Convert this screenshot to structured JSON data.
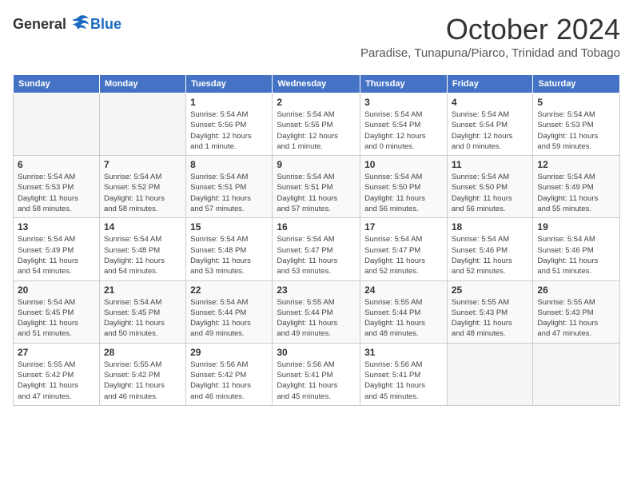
{
  "logo": {
    "general": "General",
    "blue": "Blue"
  },
  "title": "October 2024",
  "location": "Paradise, Tunapuna/Piarco, Trinidad and Tobago",
  "days_of_week": [
    "Sunday",
    "Monday",
    "Tuesday",
    "Wednesday",
    "Thursday",
    "Friday",
    "Saturday"
  ],
  "weeks": [
    [
      {
        "day": "",
        "info": ""
      },
      {
        "day": "",
        "info": ""
      },
      {
        "day": "1",
        "info": "Sunrise: 5:54 AM\nSunset: 5:56 PM\nDaylight: 12 hours\nand 1 minute."
      },
      {
        "day": "2",
        "info": "Sunrise: 5:54 AM\nSunset: 5:55 PM\nDaylight: 12 hours\nand 1 minute."
      },
      {
        "day": "3",
        "info": "Sunrise: 5:54 AM\nSunset: 5:54 PM\nDaylight: 12 hours\nand 0 minutes."
      },
      {
        "day": "4",
        "info": "Sunrise: 5:54 AM\nSunset: 5:54 PM\nDaylight: 12 hours\nand 0 minutes."
      },
      {
        "day": "5",
        "info": "Sunrise: 5:54 AM\nSunset: 5:53 PM\nDaylight: 11 hours\nand 59 minutes."
      }
    ],
    [
      {
        "day": "6",
        "info": "Sunrise: 5:54 AM\nSunset: 5:53 PM\nDaylight: 11 hours\nand 58 minutes."
      },
      {
        "day": "7",
        "info": "Sunrise: 5:54 AM\nSunset: 5:52 PM\nDaylight: 11 hours\nand 58 minutes."
      },
      {
        "day": "8",
        "info": "Sunrise: 5:54 AM\nSunset: 5:51 PM\nDaylight: 11 hours\nand 57 minutes."
      },
      {
        "day": "9",
        "info": "Sunrise: 5:54 AM\nSunset: 5:51 PM\nDaylight: 11 hours\nand 57 minutes."
      },
      {
        "day": "10",
        "info": "Sunrise: 5:54 AM\nSunset: 5:50 PM\nDaylight: 11 hours\nand 56 minutes."
      },
      {
        "day": "11",
        "info": "Sunrise: 5:54 AM\nSunset: 5:50 PM\nDaylight: 11 hours\nand 56 minutes."
      },
      {
        "day": "12",
        "info": "Sunrise: 5:54 AM\nSunset: 5:49 PM\nDaylight: 11 hours\nand 55 minutes."
      }
    ],
    [
      {
        "day": "13",
        "info": "Sunrise: 5:54 AM\nSunset: 5:49 PM\nDaylight: 11 hours\nand 54 minutes."
      },
      {
        "day": "14",
        "info": "Sunrise: 5:54 AM\nSunset: 5:48 PM\nDaylight: 11 hours\nand 54 minutes."
      },
      {
        "day": "15",
        "info": "Sunrise: 5:54 AM\nSunset: 5:48 PM\nDaylight: 11 hours\nand 53 minutes."
      },
      {
        "day": "16",
        "info": "Sunrise: 5:54 AM\nSunset: 5:47 PM\nDaylight: 11 hours\nand 53 minutes."
      },
      {
        "day": "17",
        "info": "Sunrise: 5:54 AM\nSunset: 5:47 PM\nDaylight: 11 hours\nand 52 minutes."
      },
      {
        "day": "18",
        "info": "Sunrise: 5:54 AM\nSunset: 5:46 PM\nDaylight: 11 hours\nand 52 minutes."
      },
      {
        "day": "19",
        "info": "Sunrise: 5:54 AM\nSunset: 5:46 PM\nDaylight: 11 hours\nand 51 minutes."
      }
    ],
    [
      {
        "day": "20",
        "info": "Sunrise: 5:54 AM\nSunset: 5:45 PM\nDaylight: 11 hours\nand 51 minutes."
      },
      {
        "day": "21",
        "info": "Sunrise: 5:54 AM\nSunset: 5:45 PM\nDaylight: 11 hours\nand 50 minutes."
      },
      {
        "day": "22",
        "info": "Sunrise: 5:54 AM\nSunset: 5:44 PM\nDaylight: 11 hours\nand 49 minutes."
      },
      {
        "day": "23",
        "info": "Sunrise: 5:55 AM\nSunset: 5:44 PM\nDaylight: 11 hours\nand 49 minutes."
      },
      {
        "day": "24",
        "info": "Sunrise: 5:55 AM\nSunset: 5:44 PM\nDaylight: 11 hours\nand 48 minutes."
      },
      {
        "day": "25",
        "info": "Sunrise: 5:55 AM\nSunset: 5:43 PM\nDaylight: 11 hours\nand 48 minutes."
      },
      {
        "day": "26",
        "info": "Sunrise: 5:55 AM\nSunset: 5:43 PM\nDaylight: 11 hours\nand 47 minutes."
      }
    ],
    [
      {
        "day": "27",
        "info": "Sunrise: 5:55 AM\nSunset: 5:42 PM\nDaylight: 11 hours\nand 47 minutes."
      },
      {
        "day": "28",
        "info": "Sunrise: 5:55 AM\nSunset: 5:42 PM\nDaylight: 11 hours\nand 46 minutes."
      },
      {
        "day": "29",
        "info": "Sunrise: 5:56 AM\nSunset: 5:42 PM\nDaylight: 11 hours\nand 46 minutes."
      },
      {
        "day": "30",
        "info": "Sunrise: 5:56 AM\nSunset: 5:41 PM\nDaylight: 11 hours\nand 45 minutes."
      },
      {
        "day": "31",
        "info": "Sunrise: 5:56 AM\nSunset: 5:41 PM\nDaylight: 11 hours\nand 45 minutes."
      },
      {
        "day": "",
        "info": ""
      },
      {
        "day": "",
        "info": ""
      }
    ]
  ]
}
